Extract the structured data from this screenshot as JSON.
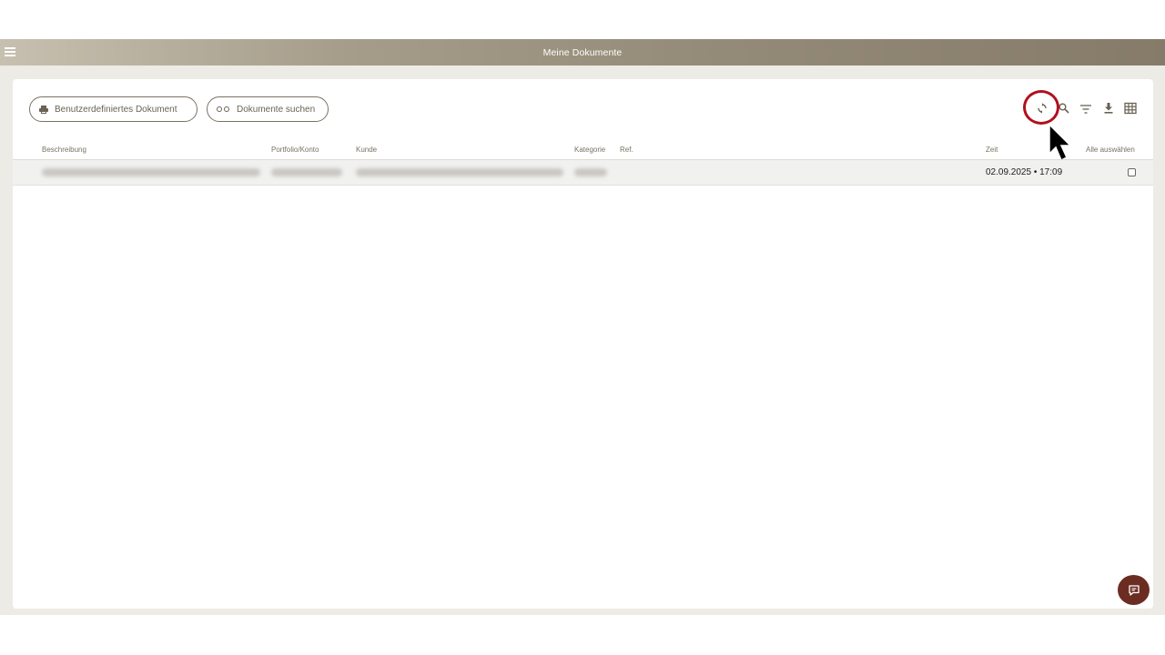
{
  "topbar": {
    "title": "Meine Dokumente"
  },
  "actions": {
    "custom_document_label": "Benutzerdefiniertes Dokument",
    "search_documents_label": "Dokumente suchen"
  },
  "table": {
    "columns": {
      "beschreibung": "Beschreibung",
      "portfolio": "Portfolio/Konto",
      "kunde": "Kunde",
      "kategorie": "Kategorie",
      "ref": "Ref.",
      "zeit": "Zeit",
      "select_all": "Alle auswählen"
    },
    "rows": [
      {
        "zeit": "02.09.2025 • 17:09"
      }
    ]
  },
  "icons": {
    "menu": "menu-icon",
    "refresh": "refresh-icon",
    "search": "search-icon",
    "filter": "filter-icon",
    "download": "download-icon",
    "grid": "grid-view-icon",
    "chat": "chat-icon"
  },
  "colors": {
    "topbar_start": "#c7c0b0",
    "topbar_end": "#857b68",
    "highlight": "#b0101e",
    "chat_button": "#6b2d22",
    "accent_text": "#6a6254"
  }
}
